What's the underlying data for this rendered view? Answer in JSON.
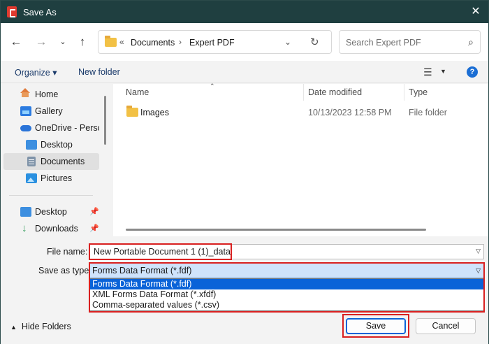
{
  "window": {
    "title": "Save As"
  },
  "address_bar": {
    "overflow": "«",
    "crumbs": [
      "Documents",
      "Expert PDF"
    ],
    "separator": "›"
  },
  "search": {
    "placeholder": "Search Expert PDF"
  },
  "toolbar": {
    "organize": "Organize ▾",
    "new_folder": "New folder",
    "help": "?"
  },
  "nav": {
    "items": [
      {
        "label": "Home",
        "icon": "home-icon"
      },
      {
        "label": "Gallery",
        "icon": "gallery-icon"
      },
      {
        "label": "OneDrive - Personal",
        "icon": "onedrive-icon"
      },
      {
        "label": "Desktop",
        "icon": "desktop-icon"
      },
      {
        "label": "Documents",
        "icon": "documents-icon",
        "selected": true
      },
      {
        "label": "Pictures",
        "icon": "pictures-icon"
      }
    ],
    "pinned": [
      {
        "label": "Desktop",
        "icon": "desktop-icon"
      },
      {
        "label": "Downloads",
        "icon": "downloads-icon"
      }
    ]
  },
  "file_list": {
    "columns": [
      "Name",
      "Date modified",
      "Type"
    ],
    "rows": [
      {
        "name": "Images",
        "date_modified": "10/13/2023 12:58 PM",
        "type": "File folder"
      }
    ]
  },
  "form": {
    "file_name_label": "File name:",
    "file_name_value": "New Portable Document 1 (1)_data",
    "save_type_label": "Save as type:",
    "save_type_value": "Forms Data Format (*.fdf)",
    "save_type_options": [
      "Forms Data Format (*.fdf)",
      "XML Forms Data Format (*.xfdf)",
      "Comma-separated values (*.csv)"
    ],
    "selected_option_index": 0
  },
  "footer": {
    "hide_folders": "Hide Folders",
    "save": "Save",
    "cancel": "Cancel"
  },
  "colors": {
    "titlebar": "#1f3f40",
    "accent": "#0a63d8",
    "highlight": "#d92020"
  }
}
